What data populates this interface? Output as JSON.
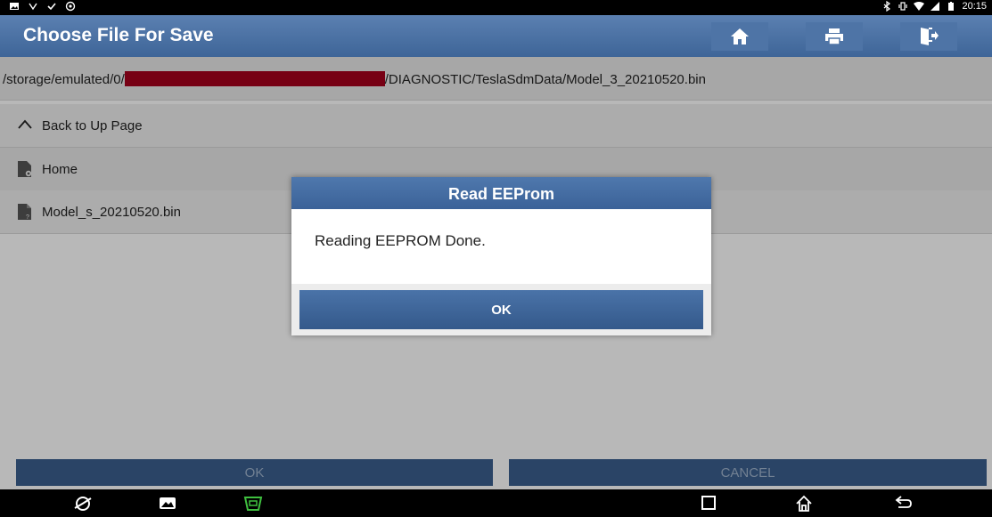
{
  "statusbar": {
    "time": "20:15"
  },
  "header": {
    "title": "Choose File For Save"
  },
  "path": {
    "prefix": "/storage/emulated/0/",
    "suffix": "/DIAGNOSTIC/TeslaSdmData/Model_3_20210520.bin"
  },
  "list": {
    "up_label": "Back to Up Page",
    "items": [
      {
        "label": "Home",
        "icon": "folder-settings-icon"
      },
      {
        "label": "Model_s_20210520.bin",
        "icon": "file-icon"
      }
    ]
  },
  "footer": {
    "ok_label": "OK",
    "cancel_label": "CANCEL"
  },
  "dialog": {
    "title": "Read EEProm",
    "message": "Reading EEPROM Done.",
    "ok_label": "OK"
  },
  "colors": {
    "accent": "#3e6598",
    "redaction": "#a6001c"
  }
}
